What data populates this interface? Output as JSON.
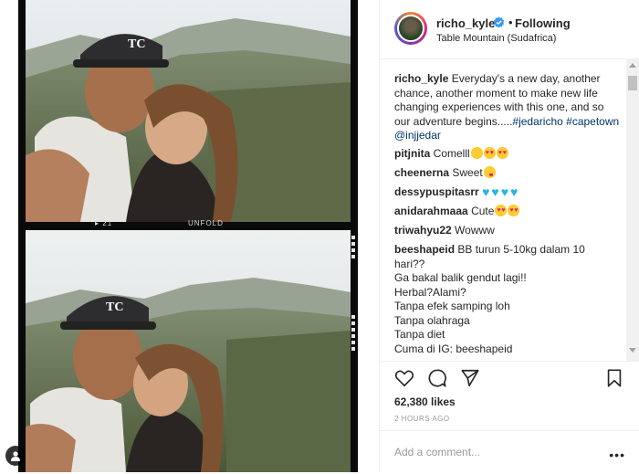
{
  "film": {
    "frame_number": "▸ 21",
    "brand": "UNFOLD"
  },
  "header": {
    "username": "richo_kyle",
    "separator": "•",
    "follow_status": "Following",
    "location": "Table Mountain (Sudafrica)"
  },
  "caption": {
    "username": "richo_kyle",
    "text": "Everyday's a new day, another chance, another moment to make new life changing experiences with this one, and so our adventure begins.....",
    "tags": [
      "#jedaricho",
      "#capetown",
      "@injjedar"
    ]
  },
  "comments": [
    {
      "user": "pitjnita",
      "text": "Comelll",
      "emoji": [
        "face-with-tears-of-joy",
        "smiling-face-heart-eyes",
        "smiling-face-heart-eyes"
      ]
    },
    {
      "user": "cheenerna",
      "text": "Sweet",
      "emoji": [
        "face-savoring-food"
      ]
    },
    {
      "user": "dessypuspitasrr",
      "text": "",
      "emoji": [
        "blue-heart",
        "blue-heart",
        "blue-heart",
        "blue-heart"
      ]
    },
    {
      "user": "anidarahmaaa",
      "text": "Cute",
      "emoji": [
        "smiling-face-heart-eyes",
        "smiling-face-heart-eyes"
      ]
    },
    {
      "user": "triwahyu22",
      "text": "Wowww",
      "emoji": []
    },
    {
      "user": "beeshapeid",
      "lines": [
        "BB turun 5-10kg dalam 10",
        "hari??",
        "Ga bakal balik gendut lagi!!",
        "Herbal?Alami?",
        "Tanpa efek samping loh",
        "Tanpa olahraga",
        "Tanpa diet",
        "Cuma di IG: beeshapeid"
      ]
    }
  ],
  "actions": {
    "likes": "62,380 likes",
    "time_ago": "2 HOURS AGO",
    "comment_placeholder": "Add a comment...",
    "more": "•••"
  },
  "colors": {
    "link": "#003569",
    "muted": "#999999",
    "border": "#efefef",
    "verified": "#3897f0"
  }
}
